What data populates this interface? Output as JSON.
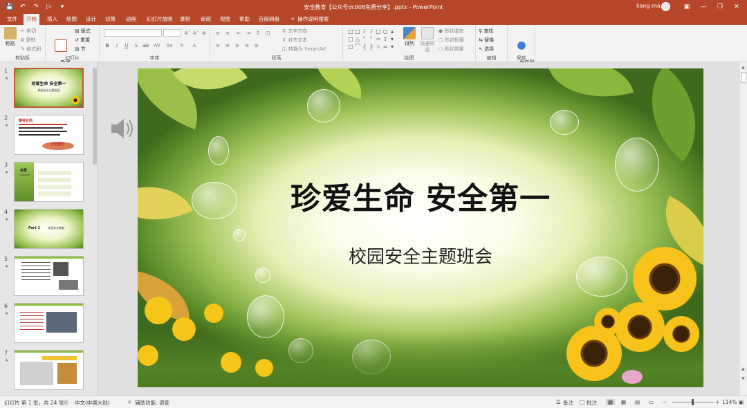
{
  "titlebar": {
    "document_title": "安全教育【公众号dc008免费分享】.pptx - PowerPoint",
    "user_name": "liang ma"
  },
  "tabs": [
    {
      "label": "文件",
      "active": false
    },
    {
      "label": "开始",
      "active": true
    },
    {
      "label": "插入",
      "active": false
    },
    {
      "label": "绘图",
      "active": false
    },
    {
      "label": "设计",
      "active": false
    },
    {
      "label": "切换",
      "active": false
    },
    {
      "label": "动画",
      "active": false
    },
    {
      "label": "幻灯片放映",
      "active": false
    },
    {
      "label": "录制",
      "active": false
    },
    {
      "label": "审阅",
      "active": false
    },
    {
      "label": "视图",
      "active": false
    },
    {
      "label": "帮助",
      "active": false
    },
    {
      "label": "百度网盘",
      "active": false
    }
  ],
  "tell_me": "操作说明搜索",
  "ribbon": {
    "clipboard": {
      "paste": "粘贴",
      "cut": "剪切",
      "copy": "复制",
      "format_painter": "格式刷",
      "label": "剪贴板"
    },
    "slides": {
      "new_slide": "新建\n幻灯片",
      "layout": "版式",
      "reset": "重置",
      "section": "节",
      "label": "幻灯片"
    },
    "font": {
      "label": "字体"
    },
    "paragraph": {
      "text_direction": "文字方向",
      "align_text": "对齐文本",
      "smartart": "转换为 SmartArt",
      "label": "段落"
    },
    "drawing": {
      "arrange": "排列",
      "quick_styles": "快速样式",
      "shape_fill": "形状填充",
      "shape_outline": "形状轮廓",
      "shape_effects": "形状效果",
      "label": "绘图"
    },
    "editing": {
      "find": "查找",
      "replace": "替换",
      "select": "选择",
      "label": "编辑"
    },
    "save": {
      "save_to_baidu": "保存到\n百度网盘",
      "label": "保存"
    }
  },
  "thumbnails": [
    {
      "num": "1",
      "title": "珍爱生命 安全第一",
      "sub": "校园安全主题班会"
    },
    {
      "num": "2",
      "title": "警钟长鸣",
      "sub": "安全警示"
    },
    {
      "num": "3",
      "title": "目录",
      "sub": "Contents"
    },
    {
      "num": "4",
      "title": "Part 1",
      "sub": "校园安全教育"
    },
    {
      "num": "5",
      "title": "",
      "sub": ""
    },
    {
      "num": "6",
      "title": "",
      "sub": ""
    },
    {
      "num": "7",
      "title": "",
      "sub": ""
    }
  ],
  "slide": {
    "title": "珍爱生命  安全第一",
    "subtitle": "校园安全主题班会"
  },
  "statusbar": {
    "slide_info": "幻灯片 第 1 张，共 24 张",
    "language": "中文(中国大陆)",
    "accessibility": "辅助功能: 调查",
    "notes": "备注",
    "comments": "批注",
    "zoom": "114%"
  },
  "colors": {
    "accent": "#b7472a",
    "selected_border": "#c55a3b"
  }
}
